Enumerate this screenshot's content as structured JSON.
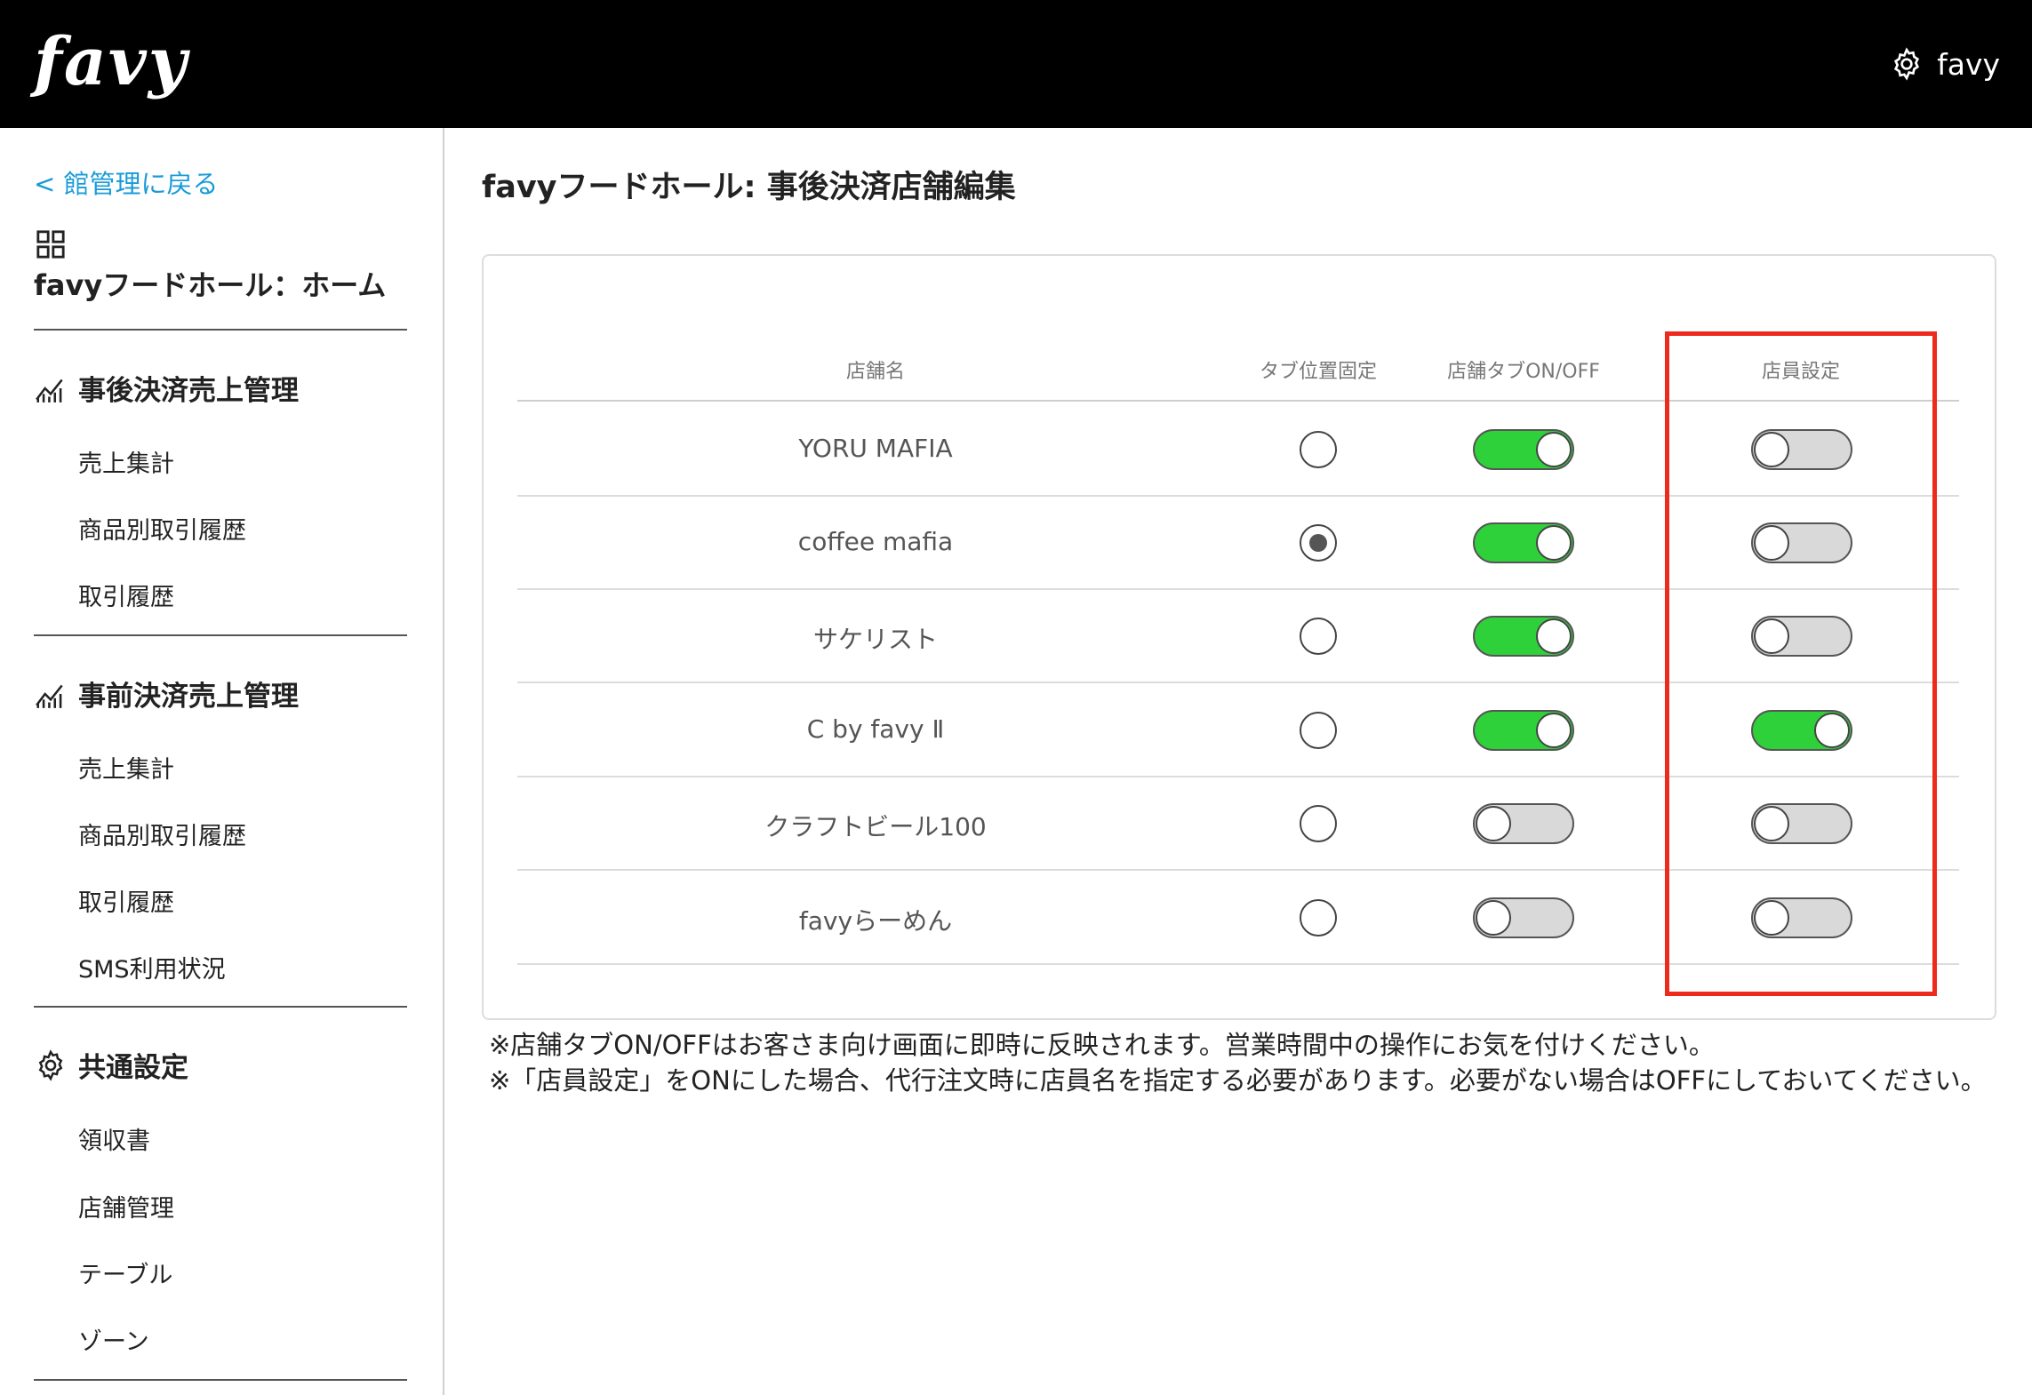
{
  "header": {
    "logo": "favy",
    "account_name": "favy",
    "icons": [
      "gear-icon"
    ]
  },
  "sidebar": {
    "back_link": "< 館管理に戻る",
    "home_title": "favyフードホール：ホーム",
    "sections": [
      {
        "title": "事後決済売上管理",
        "icon": "chart-icon",
        "items": [
          "売上集計",
          "商品別取引履歴",
          "取引履歴"
        ]
      },
      {
        "title": "事前決済売上管理",
        "icon": "chart-icon",
        "items": [
          "売上集計",
          "商品別取引履歴",
          "取引履歴",
          "SMS利用状況"
        ]
      },
      {
        "title": "共通設定",
        "icon": "gear-icon",
        "items": [
          "領収書",
          "店舗管理",
          "テーブル",
          "ゾーン"
        ]
      }
    ]
  },
  "main": {
    "title": "favyフードホール: 事後決済店舗編集",
    "table": {
      "headers": [
        "店舗名",
        "タブ位置固定",
        "店舗タブON/OFF",
        "店員設定"
      ],
      "rows": [
        {
          "name": "YORU MAFIA",
          "tab_fixed": false,
          "tab_on": true,
          "staff_setting": false
        },
        {
          "name": "coffee mafia",
          "tab_fixed": true,
          "tab_on": true,
          "staff_setting": false
        },
        {
          "name": "サケリスト",
          "tab_fixed": false,
          "tab_on": true,
          "staff_setting": false
        },
        {
          "name": "C by favy Ⅱ",
          "tab_fixed": false,
          "tab_on": true,
          "staff_setting": true
        },
        {
          "name": "クラフトビール100",
          "tab_fixed": false,
          "tab_on": false,
          "staff_setting": false
        },
        {
          "name": "favyらーめん",
          "tab_fixed": false,
          "tab_on": false,
          "staff_setting": false
        }
      ]
    },
    "notes": [
      "※店舗タブON/OFFはお客さま向け画面に即時に反映されます。営業時間中の操作にお気を付けください。",
      "※「店員設定」をONにした場合、代行注文時に店員名を指定する必要があります。必要がない場合はOFFにしておいてください。"
    ]
  },
  "colors": {
    "header_bg": "#000000",
    "link": "#1a9bd7",
    "toggle_on": "#2fd13a",
    "toggle_off": "#d9d9d9",
    "highlight": "#ee2a1c"
  }
}
